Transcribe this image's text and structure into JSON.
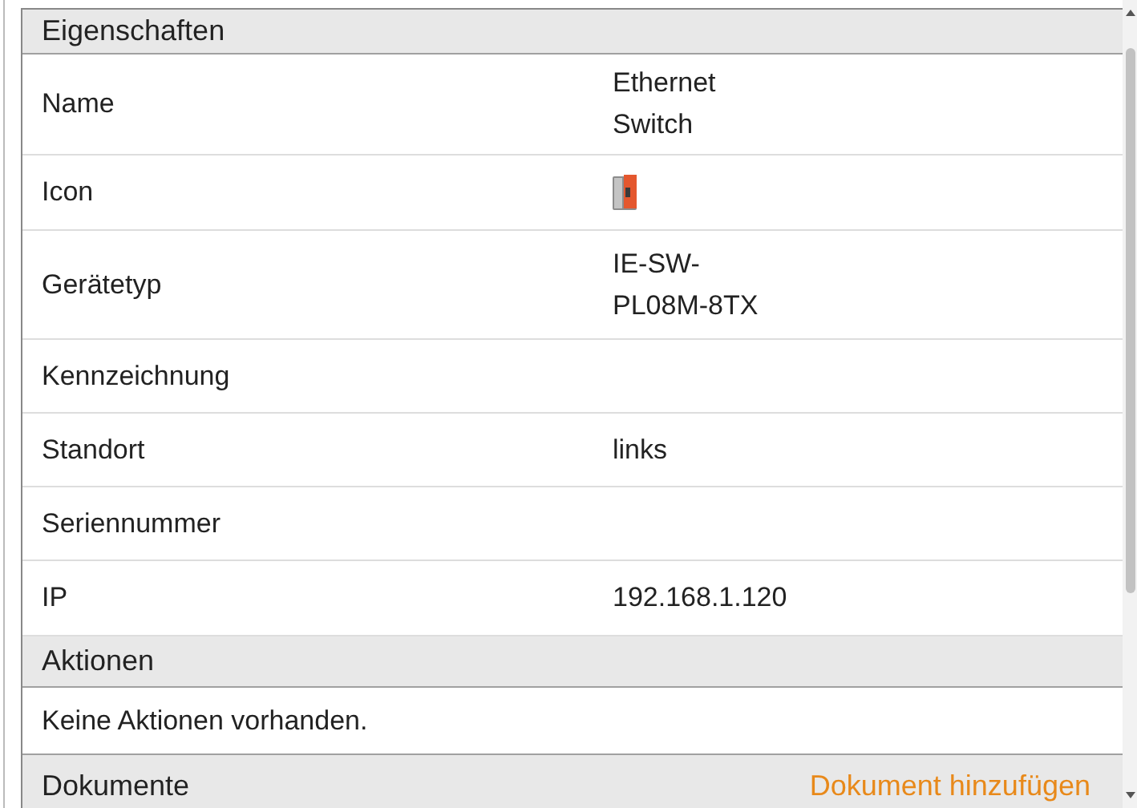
{
  "properties": {
    "title": "Eigenschaften",
    "rows": [
      {
        "kind": "text",
        "label": "Name",
        "value": "Ethernet Switch"
      },
      {
        "kind": "icon",
        "label": "Icon"
      },
      {
        "kind": "text",
        "label": "Gerätetyp",
        "value": "IE-SW-PL08M-8TX"
      },
      {
        "kind": "text",
        "label": "Kennzeichnung"
      },
      {
        "kind": "text",
        "label": "Standort",
        "value": "links"
      },
      {
        "kind": "text",
        "label": "Seriennummer"
      },
      {
        "kind": "text",
        "label": "IP",
        "value": "192.168.1.120"
      }
    ]
  },
  "actions": {
    "title": "Aktionen",
    "empty_text": "Keine Aktionen vorhanden."
  },
  "documents": {
    "title": "Dokumente",
    "add_link": "Dokument hinzufügen"
  }
}
